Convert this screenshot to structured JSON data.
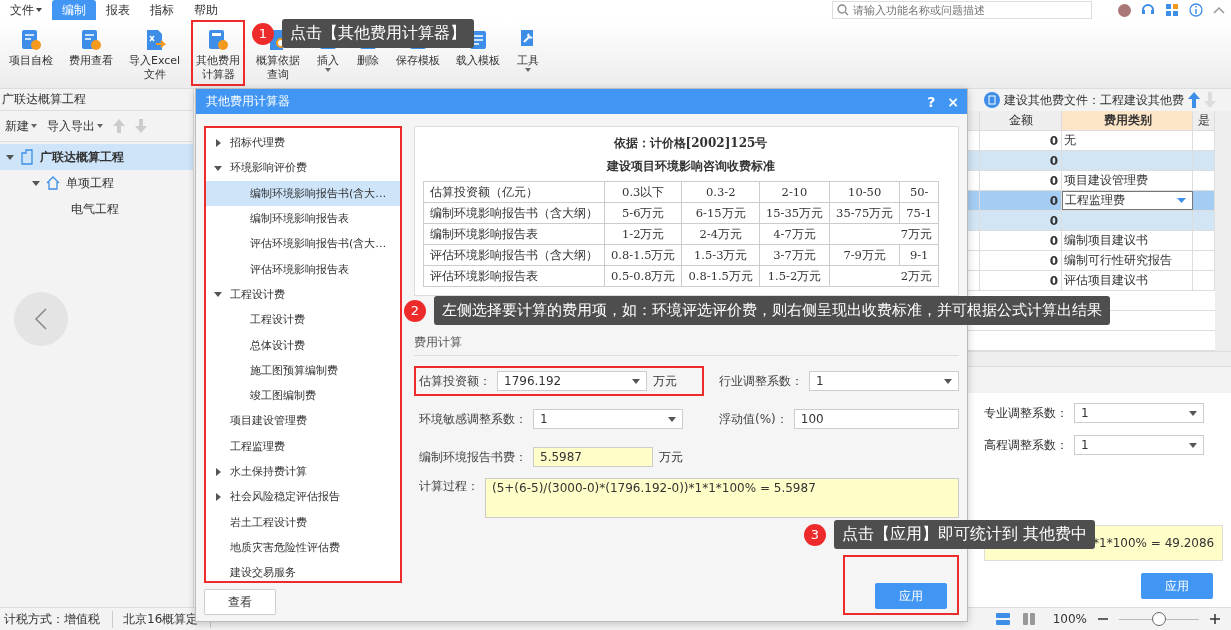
{
  "menu_tabs": [
    {
      "label": "文件",
      "dropdown": true,
      "selected": false
    },
    {
      "label": "编制",
      "dropdown": false,
      "selected": true
    },
    {
      "label": "报表",
      "dropdown": false,
      "selected": false
    },
    {
      "label": "指标",
      "dropdown": false,
      "selected": false
    },
    {
      "label": "帮助",
      "dropdown": false,
      "selected": false
    }
  ],
  "search": {
    "placeholder": "请输入功能名称或问题描述"
  },
  "ribbon": [
    {
      "lines": [
        "项目自检"
      ],
      "dropdown": false,
      "highlighted": false
    },
    {
      "lines": [
        "费用查看"
      ],
      "dropdown": false,
      "highlighted": false
    },
    {
      "lines": [
        "导入Excel",
        "文件"
      ],
      "dropdown": false,
      "highlighted": false
    },
    {
      "lines": [
        "其他费用",
        "计算器"
      ],
      "dropdown": false,
      "highlighted": true
    },
    {
      "lines": [
        "概算依据",
        "查询"
      ],
      "dropdown": false,
      "highlighted": false
    },
    {
      "lines": [
        "插入"
      ],
      "dropdown": true,
      "highlighted": false
    },
    {
      "lines": [
        "删除"
      ],
      "dropdown": false,
      "highlighted": false
    },
    {
      "lines": [
        "保存模板"
      ],
      "dropdown": false,
      "highlighted": false
    },
    {
      "lines": [
        "载入模板"
      ],
      "dropdown": false,
      "highlighted": false
    },
    {
      "lines": [
        "工具"
      ],
      "dropdown": true,
      "highlighted": false
    }
  ],
  "left_panel": {
    "title": "广联达概算工程",
    "toolbar": [
      {
        "label": "新建"
      },
      {
        "label": "导入导出"
      }
    ],
    "tree": [
      {
        "label": "广联达概算工程",
        "expanded": true,
        "selected": true,
        "children": [
          {
            "label": "单项工程",
            "expanded": true,
            "selected": false,
            "children": [
              {
                "label": "电气工程",
                "selected": false
              }
            ]
          }
        ]
      }
    ]
  },
  "other_fee": {
    "header": "建设其他费文件：工程建设其他费",
    "columns": [
      {
        "label": "金额",
        "selected": false
      },
      {
        "label": "费用类别",
        "selected": true
      },
      {
        "label": "是",
        "selected": false
      }
    ],
    "rows": [
      {
        "amount": "0",
        "category": "无",
        "kind": "item",
        "selected": false
      },
      {
        "amount": "0",
        "kind": "group",
        "selected": false
      },
      {
        "amount": "0",
        "category": "项目建设管理费",
        "kind": "item",
        "selected": false
      },
      {
        "amount": "0",
        "category": "工程监理费",
        "kind": "item",
        "selected": true
      },
      {
        "amount": "0",
        "kind": "group",
        "selected": false
      },
      {
        "amount": "0",
        "category": "编制项目建议书",
        "kind": "item",
        "selected": false
      },
      {
        "amount": "0",
        "category": "编制可行性研究报告",
        "kind": "item",
        "selected": false
      },
      {
        "amount": "0",
        "category": "评估项目建议书",
        "kind": "item",
        "selected": false
      }
    ],
    "fields": [
      {
        "label": "专业调整系数：",
        "value": "1"
      },
      {
        "label": "高程调整系数：",
        "value": "1"
      }
    ],
    "formula": "*1*100% = 49.2086",
    "apply": "应用"
  },
  "status_bar": {
    "items": [
      "计税方式：增值税",
      "北京16概算定"
    ],
    "zoom": "100%",
    "level": 0.5
  },
  "dialog": {
    "title": "其他费用计算器",
    "help": "?",
    "close": "×",
    "tree_highlighted": true,
    "tree": [
      {
        "label": "招标代理费",
        "expanded": false,
        "selected": false
      },
      {
        "label": "环境影响评价费",
        "expanded": true,
        "selected": false,
        "children": [
          {
            "label": "编制环境影响报告书(含大…",
            "selected": true
          },
          {
            "label": "编制环境影响报告表",
            "selected": false
          },
          {
            "label": "评估环境影响报告书(含大…",
            "selected": false
          },
          {
            "label": "评估环境影响报告表",
            "selected": false
          }
        ]
      },
      {
        "label": "工程设计费",
        "expanded": true,
        "selected": false,
        "children": [
          {
            "label": "工程设计费",
            "selected": false
          },
          {
            "label": "总体设计费",
            "selected": false
          },
          {
            "label": "施工图预算编制费",
            "selected": false
          },
          {
            "label": "竣工图编制费",
            "selected": false
          }
        ]
      },
      {
        "label": "项目建设管理费",
        "selected": false
      },
      {
        "label": "工程监理费",
        "selected": false
      },
      {
        "label": "水土保持费计算",
        "expanded": false,
        "selected": false
      },
      {
        "label": "社会风险稳定评估报告",
        "expanded": false,
        "selected": false
      },
      {
        "label": "岩土工程设计费",
        "selected": false
      },
      {
        "label": "地质灾害危险性评估费",
        "selected": false
      },
      {
        "label": "建设交易服务",
        "selected": false
      }
    ],
    "view_button": "查看",
    "basis": "依据：计价格[2002]125号",
    "standard_title": "建设项目环境影响咨询收费标准",
    "fee_table": [
      {
        "cells": [
          "估算投资额（亿元）",
          "0.3以下",
          "0.3-2",
          "2-10",
          "10-50",
          "50-"
        ]
      },
      {
        "cells": [
          "编制环境影响报告书（含大纲）",
          "5-6万元",
          "6-15万元",
          "15-35万元",
          "35-75万元",
          "75-1"
        ]
      },
      {
        "cells": [
          "编制环境影响报告表",
          "1-2万元",
          "2-4万元",
          "4-7万元"
        ],
        "merged_tail": "7万元"
      },
      {
        "cells": [
          "评估环境影响报告书（含大纲）",
          "0.8-1.5万元",
          "1.5-3万元",
          "3-7万元",
          "7-9万元",
          "9-1"
        ]
      },
      {
        "cells": [
          "评估环境影响报告表",
          "0.5-0.8万元",
          "0.8-1.5万元",
          "1.5-2万元"
        ],
        "merged_tail": "2万元"
      }
    ],
    "section": "费用计算",
    "fields": [
      {
        "label": "估算投资额：",
        "value": "1796.192",
        "kind": "select",
        "unit": "万元",
        "highlighted": true
      },
      {
        "label": "行业调整系数：",
        "value": "1",
        "kind": "select",
        "highlighted": false
      },
      {
        "label": "环境敏感调整系数：",
        "value": "1",
        "kind": "select",
        "highlighted": false
      },
      {
        "label": "浮动值(%)：",
        "value": "100",
        "kind": "input",
        "highlighted": false
      },
      {
        "label": "编制环境报告书费：",
        "value": "5.5987",
        "kind": "result",
        "unit": "万元",
        "highlighted": false
      }
    ],
    "process_label": "计算过程：",
    "process": "(5+(6-5)/(3000-0)*(1796.192-0))*1*1*100% = 5.5987",
    "apply": {
      "label": "应用",
      "highlighted": true
    }
  },
  "callouts": [
    {
      "number": "1",
      "text": "点击【其他费用计算器】"
    },
    {
      "number": "2",
      "text": "左侧选择要计算的费用项，如：环境评选评价费，则右侧呈现出收费标准，并可根据公式计算出结果"
    },
    {
      "number": "3",
      "text": "点击【应用】即可统计到 其他费中"
    }
  ]
}
